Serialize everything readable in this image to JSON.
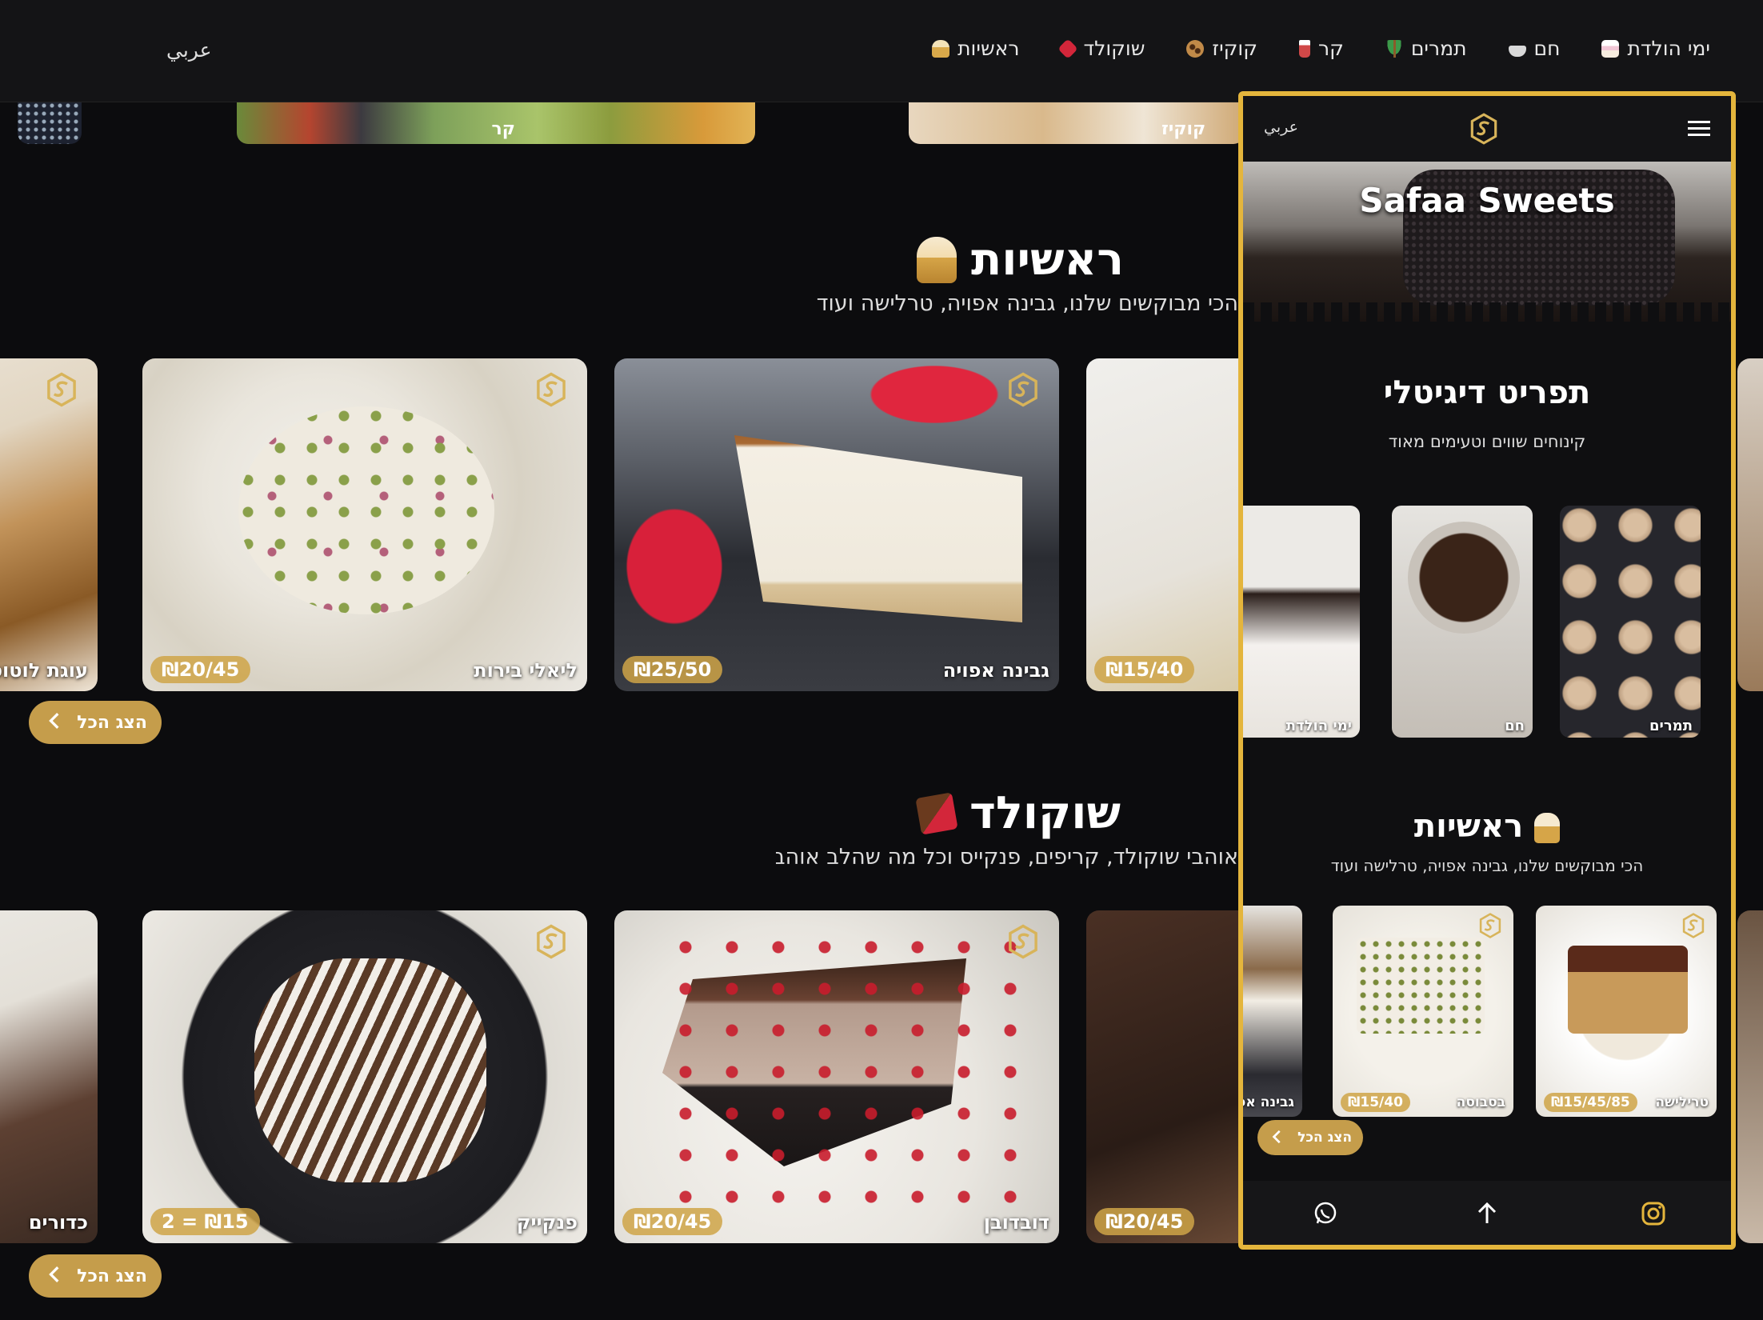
{
  "nav": {
    "lang": "عربي",
    "links": [
      {
        "label": "ראשיות",
        "icon": "cupcake-icon",
        "color": "#e9c25b"
      },
      {
        "label": "שוקולד",
        "icon": "chocolate-icon",
        "color": "#d3263a"
      },
      {
        "label": "קוקיז",
        "icon": "cookie-icon",
        "color": "#b07a3a"
      },
      {
        "label": "קר",
        "icon": "cold-drink-icon",
        "color": "#d04848"
      },
      {
        "label": "תמרים",
        "icon": "palm-tree-icon",
        "color": "#3c9a4a"
      },
      {
        "label": "חם",
        "icon": "hot-drink-icon",
        "color": "#d9d9d9"
      },
      {
        "label": "ימי הולדת",
        "icon": "birthday-cake-icon",
        "color": "#f1c7d6"
      }
    ]
  },
  "strip": {
    "cold_label": "קר",
    "cookies_label": "קוקיז"
  },
  "sections": {
    "main": {
      "title": "ראשיות",
      "subtitle": "הכי מבוקשים שלנו, גבינה אפויה, טרלישה ועוד",
      "cards": [
        {
          "name": "עוגת לוטוס",
          "price": ""
        },
        {
          "name": "ליאלי בירות",
          "price": "₪20/45"
        },
        {
          "name": "גבינה אפויה",
          "price": "₪25/50"
        },
        {
          "name": "",
          "price": "₪15/40"
        }
      ],
      "show_all": "הצג הכל"
    },
    "chocolate": {
      "title": "שוקולד",
      "subtitle": "אוהבי שוקולד, קריפים, פנקייס וכל מה שהלב אוהב",
      "cards": [
        {
          "name": "כדורים",
          "price": ""
        },
        {
          "name": "פנקייק",
          "price": "2 = ₪15"
        },
        {
          "name": "דובדובן",
          "price": "₪20/45"
        },
        {
          "name": "",
          "price": "₪20/45"
        }
      ],
      "show_all": "הצג הכל"
    }
  },
  "phone": {
    "lang": "عربي",
    "hero_title": "Safaa Sweets",
    "menu_title": "תפריט דיגיטלי",
    "menu_subtitle": "קינוחים שווים וטעימים מאוד",
    "categories": [
      {
        "label": "תמרים"
      },
      {
        "label": "חם"
      },
      {
        "label": "ימי הולדת"
      }
    ],
    "section_title": "ראשיות",
    "section_subtitle": "הכי מבוקשים שלנו, גבינה אפויה, טרלישה ועוד",
    "cards": [
      {
        "name": "טרילישה",
        "price": "₪15/45/85"
      },
      {
        "name": "בסבוסה",
        "price": "₪15/40"
      },
      {
        "name": "גבינה אפ",
        "price": ""
      }
    ],
    "show_all": "הצג הכל"
  },
  "colors": {
    "accent": "#c59d4b",
    "frame": "#e4b53c",
    "bg": "#0c0c0e"
  }
}
